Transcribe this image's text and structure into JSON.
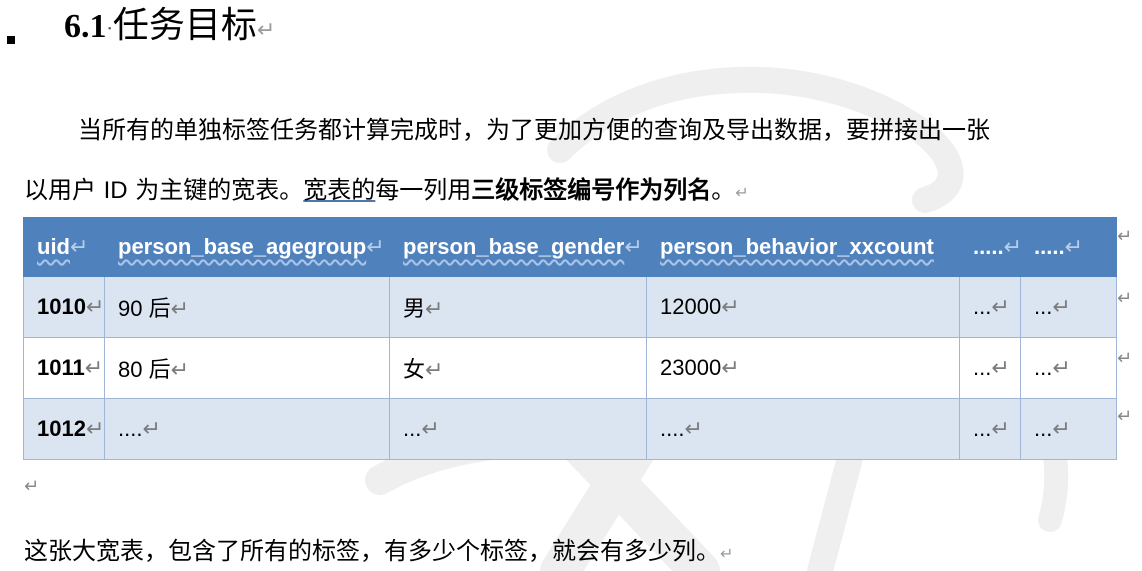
{
  "heading": {
    "number": "6.1",
    "separator": "·",
    "title": "任务目标",
    "mark": "↵"
  },
  "paragraph1": {
    "line1": "当所有的单独标签任务都计算完成时，为了更加方便的查询及导出数据，要拼接出一张",
    "line2_prefix": "以用户",
    "line2_id": "ID",
    "line2_mid": "为主键的宽表。",
    "line2_link": "宽表的",
    "line2_plain": "每一列用",
    "line2_bold": "三级标签编号作为列名",
    "line2_end": "。",
    "mark": "↵"
  },
  "table": {
    "headers": [
      "uid",
      "person_base_agegroup",
      "person_base_gender",
      "person_behavior_xxcount",
      ".....",
      "....."
    ],
    "rows": [
      [
        "1010",
        "90 后",
        "男",
        "12000",
        "...",
        "..."
      ],
      [
        "1011",
        "80 后",
        "女",
        "23000",
        "...",
        "..."
      ],
      [
        "1012",
        "....",
        "...",
        "....",
        "...",
        "..."
      ]
    ],
    "cell_mark": "↵"
  },
  "empty_paragraph_mark": "↵",
  "paragraph2": {
    "text": "这张大宽表，包含了所有的标签，有多少个标签，就会有多少列。",
    "mark": "↵"
  },
  "colors": {
    "header_bg": "#4f81bd",
    "band_bg": "#dbe5f1",
    "border": "#9fb6d6"
  }
}
